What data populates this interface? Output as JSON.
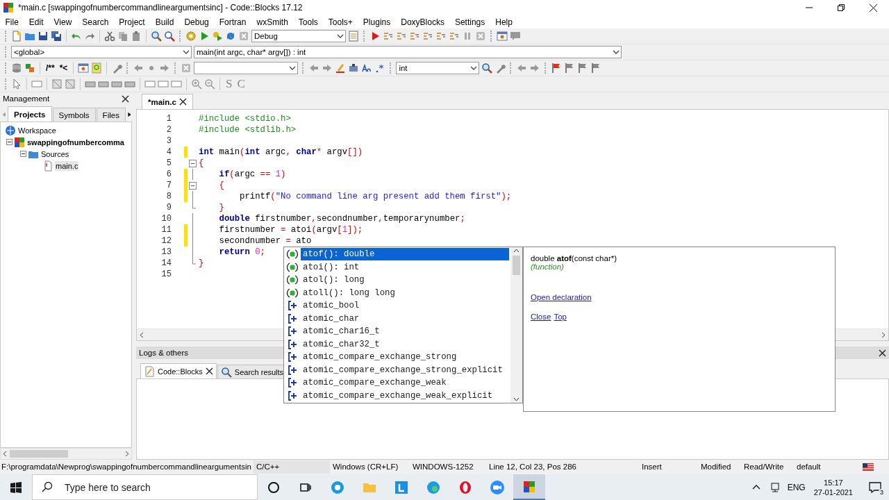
{
  "window": {
    "title": "*main.c [swappingofnumbercommandlineargumentsinc] - Code::Blocks 17.12"
  },
  "menu": [
    "File",
    "Edit",
    "View",
    "Search",
    "Project",
    "Build",
    "Debug",
    "Fortran",
    "wxSmith",
    "Tools",
    "Tools+",
    "Plugins",
    "DoxyBlocks",
    "Settings",
    "Help"
  ],
  "toolbar_main": {
    "build_target": "Debug"
  },
  "scope_bar": {
    "scope": "<global>",
    "function": "main(int argc, char* argv[]) : int"
  },
  "toolbar_doxy": {
    "buttons": [
      "/**",
      "*<"
    ],
    "search_combo": "int"
  },
  "toolbar_wxsmith": {
    "buttons": [
      "S",
      "C"
    ]
  },
  "management": {
    "title": "Management",
    "tabs": [
      {
        "label": "Projects",
        "selected": true
      },
      {
        "label": "Symbols",
        "selected": false
      },
      {
        "label": "Files",
        "selected": false
      }
    ],
    "tree": [
      {
        "label": "Workspace",
        "kind": "workspace",
        "selected": false,
        "children": [
          {
            "label": "swappingofnumbercomma",
            "kind": "project",
            "expanded": true,
            "selected": false,
            "children": [
              {
                "label": "Sources",
                "kind": "folder",
                "expanded": true,
                "selected": false,
                "children": [
                  {
                    "label": "main.c",
                    "kind": "file",
                    "selected": true
                  }
                ]
              }
            ]
          }
        ]
      }
    ]
  },
  "editor": {
    "tabs": [
      {
        "label": "*main.c",
        "selected": true
      }
    ],
    "lines": [
      {
        "number": "1",
        "kind": "plain",
        "changed": false,
        "tokens": [
          {
            "kind": "pp",
            "text": "#include <stdio.h>"
          }
        ]
      },
      {
        "number": "2",
        "kind": "plain",
        "changed": false,
        "tokens": [
          {
            "kind": "pp",
            "text": "#include <stdlib.h>"
          }
        ]
      },
      {
        "number": "3",
        "kind": "plain",
        "changed": false
      },
      {
        "number": "4",
        "kind": "plain",
        "changed": true,
        "tokens": [
          {
            "kind": "kw",
            "text": "int"
          },
          {
            "kind": "id",
            "text": " main"
          },
          {
            "kind": "op",
            "text": "("
          },
          {
            "kind": "kw",
            "text": "int"
          },
          {
            "kind": "id",
            "text": " argc"
          },
          {
            "kind": "op",
            "text": ","
          },
          {
            "kind": "kw",
            "text": " char"
          },
          {
            "kind": "op",
            "text": "*"
          },
          {
            "kind": "id",
            "text": " argv"
          },
          {
            "kind": "op",
            "text": "[])"
          }
        ]
      },
      {
        "number": "5",
        "kind": "fold_start",
        "expanded": true,
        "changed": false,
        "tokens": [
          {
            "kind": "op",
            "text": "{"
          }
        ]
      },
      {
        "number": "6",
        "kind": "fold_body",
        "changed": true,
        "tokens": [
          {
            "kind": "kw",
            "text": "    if"
          },
          {
            "kind": "op",
            "text": "("
          },
          {
            "kind": "id",
            "text": "argc "
          },
          {
            "kind": "op",
            "text": "=="
          },
          {
            "kind": "num",
            "text": " 1"
          },
          {
            "kind": "op",
            "text": ")"
          }
        ]
      },
      {
        "number": "7",
        "kind": "fold_start",
        "expanded": true,
        "changed": true,
        "tokens": [
          {
            "kind": "op",
            "text": "    {"
          }
        ]
      },
      {
        "number": "8",
        "kind": "fold_body",
        "changed": true,
        "tokens": [
          {
            "kind": "id",
            "text": "        printf"
          },
          {
            "kind": "op",
            "text": "("
          },
          {
            "kind": "str",
            "text": "\"No command line arg present add them first\""
          },
          {
            "kind": "op",
            "text": ");"
          }
        ]
      },
      {
        "number": "9",
        "kind": "fold_end",
        "changed": false,
        "tokens": [
          {
            "kind": "op",
            "text": "    }"
          }
        ]
      },
      {
        "number": "10",
        "kind": "fold_body",
        "changed": false,
        "tokens": [
          {
            "kind": "kw",
            "text": "    double"
          },
          {
            "kind": "id",
            "text": " firstnumber"
          },
          {
            "kind": "op",
            "text": ","
          },
          {
            "kind": "id",
            "text": "secondnumber"
          },
          {
            "kind": "op",
            "text": ","
          },
          {
            "kind": "id",
            "text": "temporarynumber"
          },
          {
            "kind": "op",
            "text": ";"
          }
        ]
      },
      {
        "number": "11",
        "kind": "fold_body",
        "changed": true,
        "tokens": [
          {
            "kind": "id",
            "text": "    firstnumber "
          },
          {
            "kind": "op",
            "text": "="
          },
          {
            "kind": "id",
            "text": " atoi"
          },
          {
            "kind": "op",
            "text": "("
          },
          {
            "kind": "id",
            "text": "argv"
          },
          {
            "kind": "op",
            "text": "["
          },
          {
            "kind": "num",
            "text": "1"
          },
          {
            "kind": "op",
            "text": "]);"
          }
        ]
      },
      {
        "number": "12",
        "kind": "fold_body",
        "changed": true,
        "tokens": [
          {
            "kind": "id",
            "text": "    secondnumber "
          },
          {
            "kind": "op",
            "text": "="
          },
          {
            "kind": "id",
            "text": " ato"
          }
        ]
      },
      {
        "number": "13",
        "kind": "fold_body",
        "changed": false,
        "tokens": [
          {
            "kind": "kw",
            "text": "    return"
          },
          {
            "kind": "num",
            "text": " 0"
          },
          {
            "kind": "op",
            "text": ";"
          }
        ]
      },
      {
        "number": "14",
        "kind": "fold_end",
        "changed": false,
        "tokens": [
          {
            "kind": "op",
            "text": "}"
          }
        ]
      },
      {
        "number": "15",
        "kind": "plain",
        "changed": false
      }
    ]
  },
  "autocomplete": {
    "items": [
      {
        "label": "atof(): double",
        "kind": "function",
        "selected": true
      },
      {
        "label": "atoi(): int",
        "kind": "function",
        "selected": false
      },
      {
        "label": "atol(): long",
        "kind": "function",
        "selected": false
      },
      {
        "label": "atoll(): long long",
        "kind": "function",
        "selected": false
      },
      {
        "label": "atomic_bool",
        "kind": "class",
        "selected": false
      },
      {
        "label": "atomic_char",
        "kind": "class",
        "selected": false
      },
      {
        "label": "atomic_char16_t",
        "kind": "class",
        "selected": false
      },
      {
        "label": "atomic_char32_t",
        "kind": "class",
        "selected": false
      },
      {
        "label": "atomic_compare_exchange_strong",
        "kind": "class",
        "selected": false
      },
      {
        "label": "atomic_compare_exchange_strong_explicit",
        "kind": "class",
        "selected": false
      },
      {
        "label": "atomic_compare_exchange_weak",
        "kind": "class",
        "selected": false
      },
      {
        "label": "atomic_compare_exchange_weak_explicit",
        "kind": "class",
        "selected": false
      }
    ]
  },
  "doc_popup": {
    "signature": "double **atof**(const char*)",
    "kind_label": "(function)",
    "link": "Open declaration",
    "nav_links": [
      "Close",
      "Top"
    ]
  },
  "logs": {
    "title": "Logs & others",
    "tabs": [
      {
        "label": "Code::Blocks",
        "selected": true
      },
      {
        "label": "Search results",
        "selected": false
      }
    ]
  },
  "status_bar": [
    "F:\\programdata\\Newprog\\swappingofnumbercommandlineargumentsin",
    "C/C++",
    "Windows (CR+LF)",
    "WINDOWS-1252",
    "Line 12, Col 23, Pos 286",
    "Insert",
    "Modified",
    "Read/Write",
    "default"
  ],
  "taskbar": {
    "search_placeholder": "Type here to search",
    "language": "ENG",
    "time": "15:17",
    "date": "27-01-2021",
    "notifications": "3"
  }
}
